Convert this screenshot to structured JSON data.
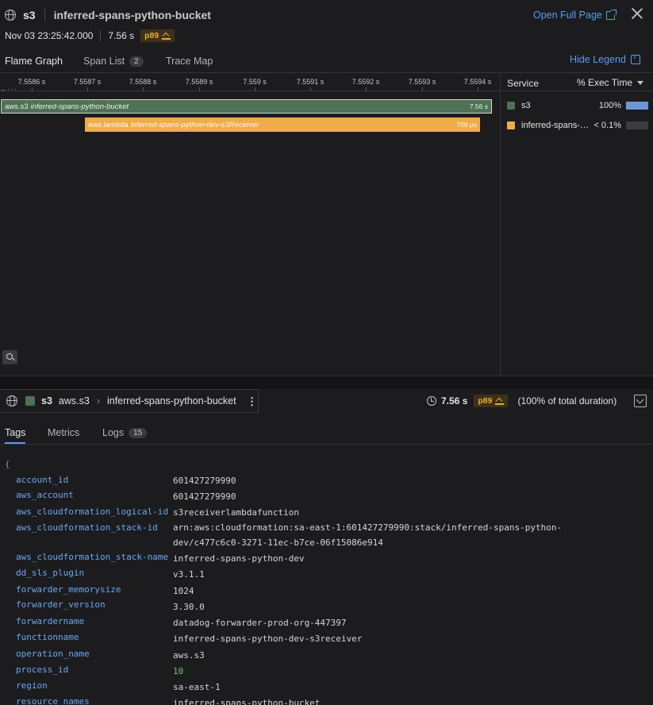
{
  "header": {
    "service": "s3",
    "resource": "inferred-spans-python-bucket",
    "open_full_page": "Open Full Page",
    "timestamp": "Nov 03 23:25:42.000",
    "duration": "7.56 s",
    "percentile": "p89"
  },
  "tabs_top": [
    {
      "label": "Flame Graph",
      "count": null
    },
    {
      "label": "Span List",
      "count": "2"
    },
    {
      "label": "Trace Map",
      "count": null
    }
  ],
  "hide_legend": "Hide Legend",
  "flame": {
    "ticks": [
      "7.5586 s",
      "7.5587 s",
      "7.5588 s",
      "7.5589 s",
      "7.559 s",
      "7.5591 s",
      "7.5592 s",
      "7.5593 s",
      "7.5594 s"
    ],
    "spans": [
      {
        "op": "aws.s3",
        "resource": "inferred-spans-python-bucket",
        "duration": "7.56 s",
        "color": "#4f7155"
      },
      {
        "op": "aws.lambda",
        "resource": "inferred-spans-python-dev-s3Receiver",
        "duration": "709 µs",
        "color": "#f0ac4b"
      }
    ]
  },
  "legend": {
    "col_service": "Service",
    "col_exec": "% Exec Time",
    "rows": [
      {
        "name": "s3",
        "pct": "100%",
        "fraction": 1.0,
        "color": "#4f7155"
      },
      {
        "name": "inferred-spans-python-dev",
        "pct": "< 0.1%",
        "fraction": 0.0,
        "color": "#f0ac4b"
      }
    ]
  },
  "span_info": {
    "service": "s3",
    "operation": "aws.s3",
    "resource": "inferred-spans-python-bucket",
    "duration": "7.56 s",
    "percentile": "p89",
    "total": "(100% of total duration)"
  },
  "tabs_bottom": [
    {
      "label": "Tags",
      "count": null
    },
    {
      "label": "Metrics",
      "count": null
    },
    {
      "label": "Logs",
      "count": "15"
    }
  ],
  "tags": {
    "brace": "{",
    "items": [
      {
        "key": "account_id",
        "value": "601427279990"
      },
      {
        "key": "aws_account",
        "value": "601427279990"
      },
      {
        "key": "aws_cloudformation_logical-id",
        "value": "s3receiverlambdafunction"
      },
      {
        "key": "aws_cloudformation_stack-id",
        "value": "arn:aws:cloudformation:sa-east-1:601427279990:stack/inferred-spans-python-",
        "value2": "dev/c477c6c0-3271-11ec-b7ce-06f15086e914"
      },
      {
        "key": "aws_cloudformation_stack-name",
        "value": "inferred-spans-python-dev"
      },
      {
        "key": "dd_sls_plugin",
        "value": "v3.1.1"
      },
      {
        "key": "forwarder_memorysize",
        "value": "1024"
      },
      {
        "key": "forwarder_version",
        "value": "3.30.0"
      },
      {
        "key": "forwardername",
        "value": "datadog-forwarder-prod-org-447397"
      },
      {
        "key": "functionname",
        "value": "inferred-spans-python-dev-s3receiver"
      },
      {
        "key": "operation_name",
        "value": "aws.s3"
      },
      {
        "key": "process_id",
        "value": "10"
      },
      {
        "key": "region",
        "value": "sa-east-1"
      },
      {
        "key": "resource_names",
        "value": "inferred-spans-python-bucket"
      }
    ]
  }
}
